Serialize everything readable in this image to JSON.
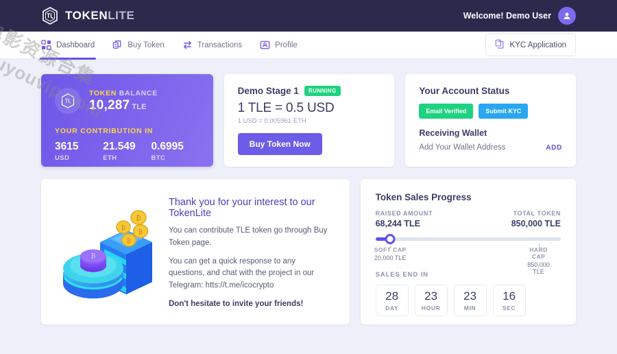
{
  "header": {
    "brand_bold": "TOKEN",
    "brand_light": "LITE",
    "welcome": "Welcome! Demo User",
    "avatar_icon": "user-icon"
  },
  "nav": {
    "items": [
      {
        "label": "Dashboard",
        "icon": "grid-icon",
        "active": true
      },
      {
        "label": "Buy Token",
        "icon": "coins-icon",
        "active": false
      },
      {
        "label": "Transactions",
        "icon": "exchange-arrows-icon",
        "active": false
      },
      {
        "label": "Profile",
        "icon": "user-card-icon",
        "active": false
      }
    ],
    "kyc_button": "KYC Application",
    "kyc_icon": "copy-document-icon"
  },
  "balance_card": {
    "title_strong": "TOKEN",
    "title_light": "BALANCE",
    "amount": "10,287",
    "amount_unit": "TLE",
    "contribution_label": "YOUR CONTRIBUTION IN",
    "contributions": [
      {
        "value": "3615",
        "unit": "USD"
      },
      {
        "value": "21.549",
        "unit": "ETH"
      },
      {
        "value": "0.6995",
        "unit": "BTC"
      }
    ],
    "icon": "token-cube-icon"
  },
  "stage_card": {
    "stage_name": "Demo Stage 1",
    "status_badge": "RUNNING",
    "rate": "1 TLE = 0.5 USD",
    "rate_sub": "1 USD = 0.005961 ETH",
    "buy_button": "Buy Token Now"
  },
  "status_card": {
    "title": "Your Account Status",
    "badges": [
      {
        "label": "Email Verified",
        "color": "#1ed37f"
      },
      {
        "label": "Submit KYC",
        "color": "#29a6f0"
      }
    ],
    "wallet_title": "Receiving Wallet",
    "wallet_text": "Add Your Wallet Address",
    "wallet_action": "ADD"
  },
  "welcome_card": {
    "title": "Thank you for your interest to our TokenLite",
    "p1": "You can contribute TLE token go through Buy Token page.",
    "p2": "You can get a quick response to any questions, and chat with the project in our Telegram: htts://t.me/icocrypto",
    "p3": "Don't hesitate to invite your friends!",
    "illustration": "isometric-token-stack-illustration"
  },
  "progress_card": {
    "title": "Token Sales Progress",
    "raised_label": "RAISED AMOUNT",
    "raised_value": "68,244 TLE",
    "total_label": "TOTAL TOKEN",
    "total_value": "850,000 TLE",
    "soft_cap_label": "SOFT CAP",
    "soft_cap_value": "20,000 TLE",
    "hard_cap_label": "HARD CAP",
    "hard_cap_value": "850,000 TLE",
    "sales_end_label": "SALES END IN",
    "timer": [
      {
        "value": "28",
        "label": "DAY"
      },
      {
        "value": "23",
        "label": "HOUR"
      },
      {
        "value": "23",
        "label": "MIN"
      },
      {
        "value": "16",
        "label": "SEC"
      }
    ]
  },
  "chart_data": {
    "type": "bar",
    "title": "Token Sales Progress",
    "categories": [
      "Raised",
      "Soft Cap",
      "Hard Cap / Total"
    ],
    "values": [
      68244,
      20000,
      850000
    ],
    "unit": "TLE",
    "progress_percent": 8,
    "soft_cap_percent": 8,
    "hard_cap_percent": 88,
    "xlabel": "",
    "ylabel": "TLE",
    "ylim": [
      0,
      850000
    ]
  },
  "watermark": {
    "line1": "电影资源合集",
    "line2": "douyouvip.com"
  }
}
